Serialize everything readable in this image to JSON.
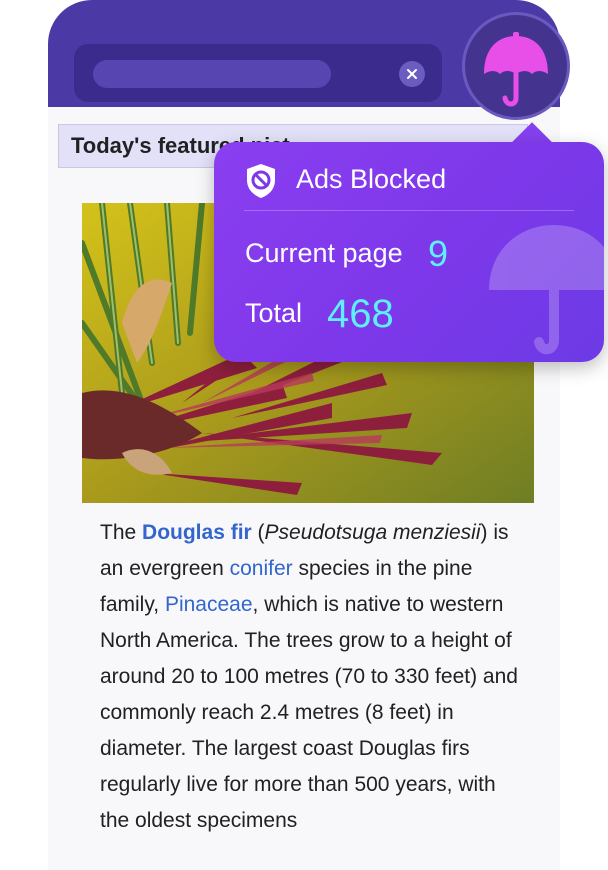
{
  "heading": {
    "text": "Today's featured pict"
  },
  "article": {
    "p1": "The ",
    "link_douglas": "Douglas fir",
    "p2": " (",
    "italic_species": "Pseudotsuga menziesii",
    "p3": ") is an evergreen ",
    "link_conifer": "conifer",
    "p4": " species in the pine family, ",
    "link_pinaceae": "Pinaceae",
    "p5": ", which is native to western North America. The trees grow to a height of around 20 to 100 metres (70 to 330 feet) and commonly reach 2.4 metres (8 feet) in diameter. The largest coast Douglas firs regularly live for more than 500 years, with the oldest specimens"
  },
  "popup": {
    "title": "Ads Blocked",
    "current_label": "Current page",
    "current_value": "9",
    "total_label": "Total",
    "total_value": "468"
  },
  "icons": {
    "badge": "umbrella-icon",
    "shield": "shield-block-icon",
    "clear": "close-icon"
  },
  "colors": {
    "topbar": "#4b3aa6",
    "popup": "#7e38ea",
    "accent_value": "#5ef0ff",
    "umbrella": "#e84ee8",
    "link": "#3366cc"
  }
}
